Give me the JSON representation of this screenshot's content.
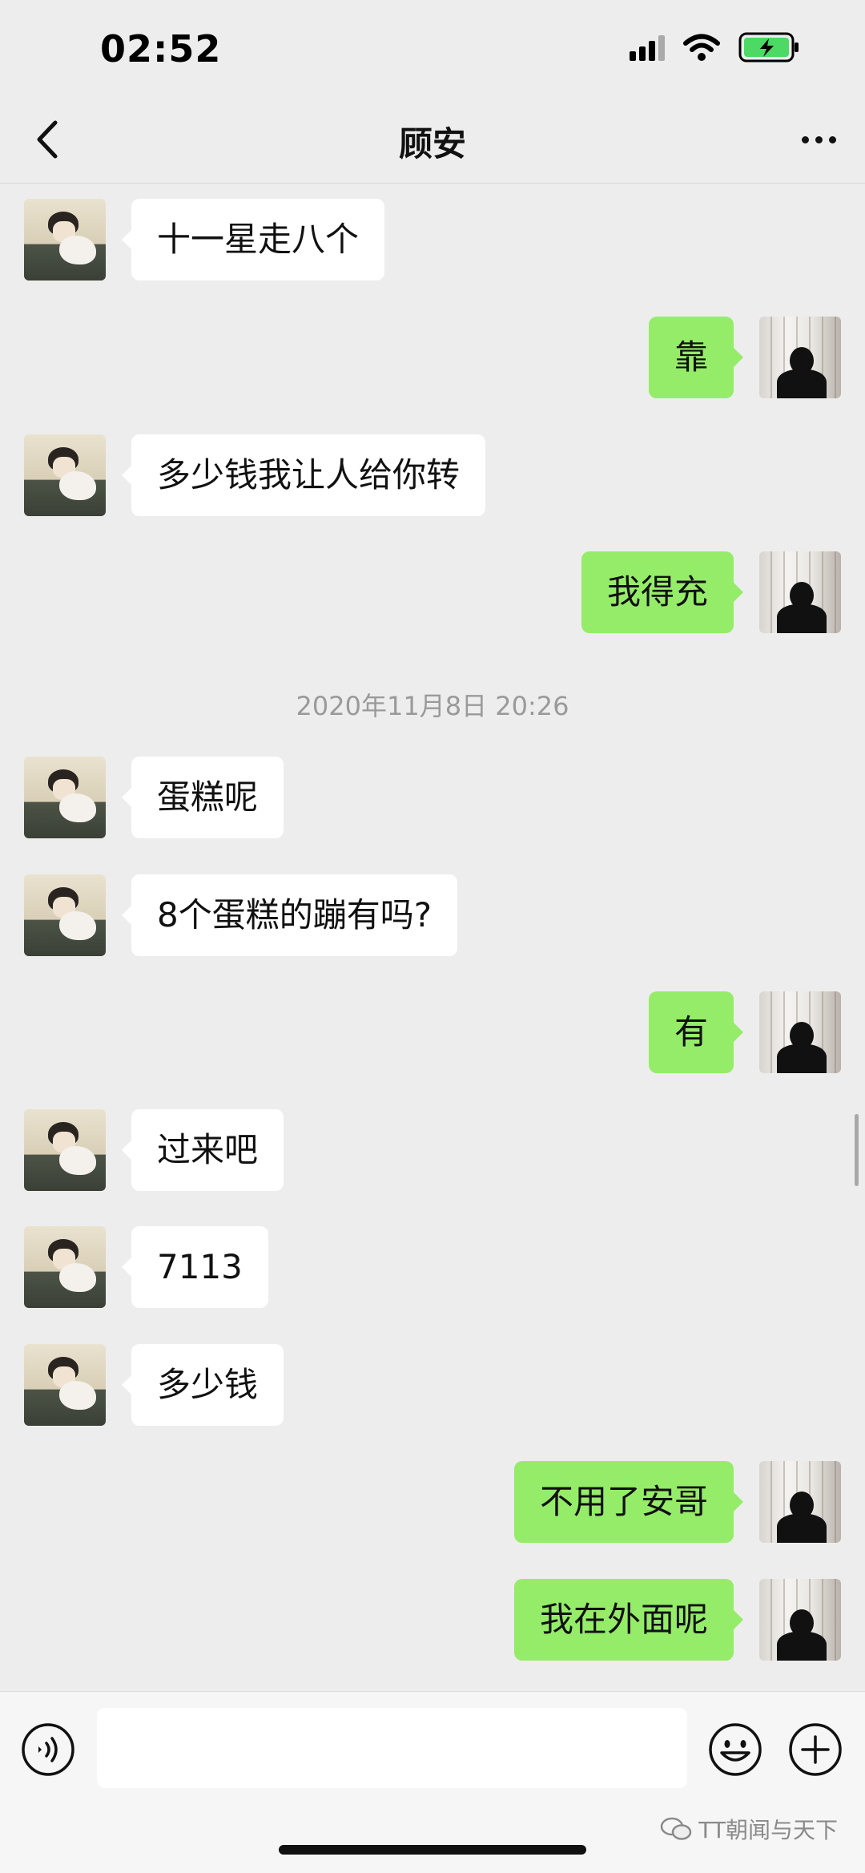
{
  "status_bar": {
    "time": "02:52",
    "icons": [
      "cellular-signal-icon",
      "wifi-icon",
      "battery-charging-icon"
    ]
  },
  "nav": {
    "title": "顾安",
    "back_icon": "chevron-left-icon",
    "more_icon": "more-dots-icon"
  },
  "timestamp": "2020年11月8日 20:26",
  "messages": [
    {
      "sender": "other",
      "text": "十一星走八个"
    },
    {
      "sender": "self",
      "text": "靠"
    },
    {
      "sender": "other",
      "text": "多少钱我让人给你转"
    },
    {
      "sender": "self",
      "text": "我得充"
    },
    {
      "sender": "other",
      "text": "蛋糕呢"
    },
    {
      "sender": "other",
      "text": "8个蛋糕的蹦有吗?"
    },
    {
      "sender": "self",
      "text": "有"
    },
    {
      "sender": "other",
      "text": "过来吧"
    },
    {
      "sender": "other",
      "text": "7113"
    },
    {
      "sender": "other",
      "text": "多少钱"
    },
    {
      "sender": "self",
      "text": "不用了安哥"
    },
    {
      "sender": "self",
      "text": "我在外面呢"
    }
  ],
  "input_bar": {
    "value": "",
    "icons": [
      "voice-icon",
      "emoji-icon",
      "plus-icon"
    ]
  },
  "watermark": "TT朝闻与天下",
  "colors": {
    "background": "#ededed",
    "self_bubble": "#95ec69",
    "other_bubble": "#ffffff",
    "timestamp_text": "#9a9a9a"
  }
}
